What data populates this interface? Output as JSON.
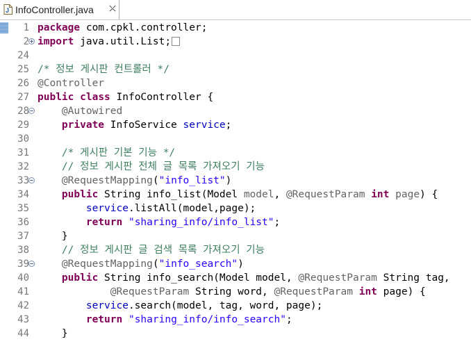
{
  "tab": {
    "title": "InfoController.java",
    "icon": "java-file-icon",
    "close_icon": "close-icon"
  },
  "colors": {
    "keyword": "#7f0055",
    "comment": "#3f7f5f",
    "annotation": "#646464",
    "string": "#2a00ff",
    "field": "#0000c0",
    "line_number": "#787878"
  },
  "lines": [
    {
      "number": "1",
      "segments": [
        {
          "t": "package",
          "c": "kw"
        },
        {
          "t": " com.cpkl.controller;"
        }
      ]
    },
    {
      "number": "2",
      "fold": "expand",
      "segments": [
        {
          "t": "import",
          "c": "kw"
        },
        {
          "t": " java.util.List;"
        },
        {
          "c": "cbox"
        }
      ]
    },
    {
      "number": "24",
      "segments": []
    },
    {
      "number": "25",
      "segments": [
        {
          "t": "/* ",
          "c": "cm"
        },
        {
          "t": "정보 게시판 컨트롤러",
          "c": "cm ko"
        },
        {
          "t": " */",
          "c": "cm"
        }
      ]
    },
    {
      "number": "26",
      "segments": [
        {
          "t": "@Controller",
          "c": "an"
        }
      ]
    },
    {
      "number": "27",
      "segments": [
        {
          "t": "public",
          "c": "kw"
        },
        {
          "t": " "
        },
        {
          "t": "class",
          "c": "kw"
        },
        {
          "t": " InfoController {"
        }
      ]
    },
    {
      "number": "28",
      "fold": "collapse",
      "segments": [
        {
          "t": "    "
        },
        {
          "t": "@Autowired",
          "c": "an"
        }
      ]
    },
    {
      "number": "29",
      "segments": [
        {
          "t": "    "
        },
        {
          "t": "private",
          "c": "kw"
        },
        {
          "t": " InfoService "
        },
        {
          "t": "service",
          "c": "fld"
        },
        {
          "t": ";"
        }
      ]
    },
    {
      "number": "30",
      "segments": []
    },
    {
      "number": "31",
      "segments": [
        {
          "t": "    "
        },
        {
          "t": "/* ",
          "c": "cm"
        },
        {
          "t": "게시판 기본 기능",
          "c": "cm ko"
        },
        {
          "t": " */",
          "c": "cm"
        }
      ]
    },
    {
      "number": "32",
      "segments": [
        {
          "t": "    "
        },
        {
          "t": "// ",
          "c": "cm"
        },
        {
          "t": "정보 게시판 전체 글 목록 가져오기 기능",
          "c": "cm ko"
        }
      ]
    },
    {
      "number": "33",
      "fold": "collapse",
      "segments": [
        {
          "t": "    "
        },
        {
          "t": "@RequestMapping",
          "c": "an"
        },
        {
          "t": "("
        },
        {
          "t": "\"info_list\"",
          "c": "str"
        },
        {
          "t": ")"
        }
      ]
    },
    {
      "number": "34",
      "segments": [
        {
          "t": "    "
        },
        {
          "t": "public",
          "c": "kw"
        },
        {
          "t": " String info_list(Model "
        },
        {
          "t": "model",
          "c": "an"
        },
        {
          "t": ", "
        },
        {
          "t": "@RequestParam",
          "c": "an"
        },
        {
          "t": " "
        },
        {
          "t": "int",
          "c": "kw"
        },
        {
          "t": " "
        },
        {
          "t": "page",
          "c": "an"
        },
        {
          "t": ") {"
        }
      ]
    },
    {
      "number": "35",
      "segments": [
        {
          "t": "        "
        },
        {
          "t": "service",
          "c": "fld"
        },
        {
          "t": ".listAll(model,page);"
        }
      ]
    },
    {
      "number": "36",
      "segments": [
        {
          "t": "        "
        },
        {
          "t": "return",
          "c": "kw"
        },
        {
          "t": " "
        },
        {
          "t": "\"sharing_info/info_list\"",
          "c": "str"
        },
        {
          "t": ";"
        }
      ]
    },
    {
      "number": "37",
      "segments": [
        {
          "t": "    }"
        }
      ]
    },
    {
      "number": "38",
      "segments": [
        {
          "t": "    "
        },
        {
          "t": "// ",
          "c": "cm"
        },
        {
          "t": "정보 게시판 글 검색 목록 가져오기 기능",
          "c": "cm ko"
        }
      ]
    },
    {
      "number": "39",
      "fold": "collapse",
      "segments": [
        {
          "t": "    "
        },
        {
          "t": "@RequestMapping",
          "c": "an"
        },
        {
          "t": "("
        },
        {
          "t": "\"info_search\"",
          "c": "str"
        },
        {
          "t": ")"
        }
      ]
    },
    {
      "number": "40",
      "segments": [
        {
          "t": "    "
        },
        {
          "t": "public",
          "c": "kw"
        },
        {
          "t": " String info_search(Model model, "
        },
        {
          "t": "@RequestParam",
          "c": "an"
        },
        {
          "t": " String tag,"
        }
      ]
    },
    {
      "number": "41",
      "segments": [
        {
          "t": "            "
        },
        {
          "t": "@RequestParam",
          "c": "an"
        },
        {
          "t": " String word, "
        },
        {
          "t": "@RequestParam",
          "c": "an"
        },
        {
          "t": " "
        },
        {
          "t": "int",
          "c": "kw"
        },
        {
          "t": " page) {"
        }
      ]
    },
    {
      "number": "42",
      "segments": [
        {
          "t": "        "
        },
        {
          "t": "service",
          "c": "fld"
        },
        {
          "t": ".search(model, tag, word, page);"
        }
      ]
    },
    {
      "number": "43",
      "segments": [
        {
          "t": "        "
        },
        {
          "t": "return",
          "c": "kw"
        },
        {
          "t": " "
        },
        {
          "t": "\"sharing_info/info_search\"",
          "c": "str"
        },
        {
          "t": ";"
        }
      ]
    },
    {
      "number": "44",
      "segments": [
        {
          "t": "    }"
        }
      ]
    }
  ]
}
